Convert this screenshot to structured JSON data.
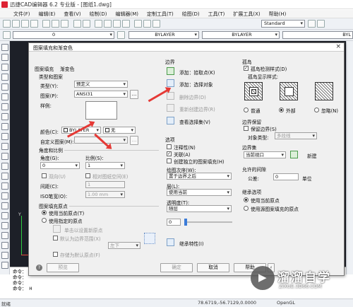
{
  "app": {
    "title": "迅捷CAD编辑器 6.2 专业版 - [图纸1.dwg]"
  },
  "menu": [
    "文件(F)",
    "编辑(E)",
    "查看(V)",
    "绘制(D)",
    "编辑器(M)",
    "定制工具(T)",
    "绘图(D)",
    "工具(T)",
    "扩展工具(X)",
    "帮助(H)"
  ],
  "toolbar": {
    "layer_value": "0",
    "linetype_a": "BYLAYER",
    "linetype_b": "BYLAYER",
    "linetype_c": "BYL",
    "style_value": "Standard"
  },
  "cmd": {
    "lines": [
      "命令：",
      "命令：",
      "命令：",
      "命令： H"
    ]
  },
  "status": {
    "ready": "就绪",
    "coords": "78.6719,-56.7129,0.0000",
    "opengl": "OpenGL"
  },
  "dialog": {
    "title": "图案填充和渐变色",
    "close": "×",
    "tabs": [
      "图案填充",
      "渐变色"
    ],
    "type_pattern": {
      "label": "类型和图案",
      "type_label": "类型(Y):",
      "type_value": "预定义",
      "pattern_label": "图案(P):",
      "pattern_value": "ANSI31",
      "swatch_label": "样例:",
      "color_label": "颜色(C):",
      "color_value": "BYLAYER",
      "bg_value": "无",
      "custom_label": "自定义图案(M):"
    },
    "angle_scale": {
      "label": "角度和比例",
      "angle_label": "角度(G):",
      "angle_value": "0",
      "scale_label": "比例(S):",
      "scale_value": "1",
      "double_label": "双向(U)",
      "relative_label": "相对图纸空间(E)",
      "spacing_label": "间距(C):",
      "spacing_value": "1",
      "iso_label": "ISO笔宽(O):",
      "iso_value": "1.00 mm"
    },
    "origin": {
      "label": "图案填充原点",
      "use_current": "使用当前原点(T)",
      "specified": "使用指定的原点",
      "click_set": "单击以设置新原点",
      "default_extent": "默认为边界范围(X)",
      "extent_value": "左下",
      "store_default": "存储为默认原点(F)"
    },
    "boundaries": {
      "label": "边界",
      "add_pick": "添加：拾取点(K)",
      "add_select": "添加：选择对象",
      "remove": "删除边界(D)",
      "recreate": "重新创建边界(R)",
      "view_sel": "查看选择集(V)"
    },
    "options": {
      "label": "选项",
      "annotative": "注释性(N)",
      "associative": "关联(A)",
      "separate": "创建独立的图案填充(H)",
      "draw_order_label": "绘图次序(W):",
      "draw_order_value": "置于边界之后",
      "layer_label": "层(L):",
      "layer_value": "使用当前",
      "transparency_label": "透明度(T):",
      "transparency_value": "随层",
      "transparency_num": "0"
    },
    "inherit": "继承特性(I)",
    "islands": {
      "label": "孤岛",
      "detect": "孤岛检测样式(D)",
      "display_label": "孤岛显示样式:",
      "normal": "普通",
      "outer": "外部",
      "ignore": "忽略(N)"
    },
    "retention": {
      "label": "边界保留",
      "retain": "保留边界(S)",
      "object_type_label": "对象类型:",
      "object_type_value": "多段线"
    },
    "boundary_set": {
      "label": "边界集",
      "value": "当前视口",
      "new": "新建"
    },
    "gap": {
      "label": "允许的间隙",
      "tolerance_label": "公差:",
      "tolerance_value": "0",
      "unit": "单位"
    },
    "inherit_opts": {
      "label": "继承选项",
      "use_current": "使用当前原点",
      "use_source": "使用源图案填充的原点"
    },
    "buttons": {
      "preview": "预览",
      "ok": "确定",
      "cancel": "取消",
      "help": "帮助"
    }
  },
  "watermark": {
    "text": "溜溜自学",
    "sub": "ZIXUE.3D66.COM"
  },
  "colors": {
    "accent": "#e53935",
    "canvas": "#1d2028"
  }
}
